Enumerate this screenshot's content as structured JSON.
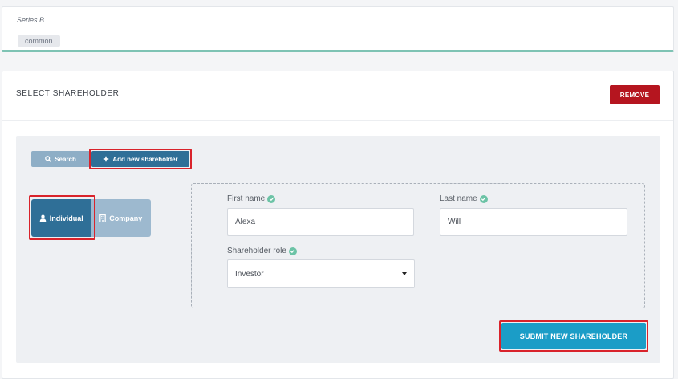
{
  "series": {
    "name": "Series B",
    "share_class": "common"
  },
  "shareholder_card": {
    "title": "SELECT SHAREHOLDER",
    "remove_label": "REMOVE"
  },
  "toolbar": {
    "search_label": "Search",
    "add_label": "Add new shareholder"
  },
  "type_toggle": {
    "individual_label": "Individual",
    "company_label": "Company",
    "selected": "Individual"
  },
  "form": {
    "first_name_label": "First name",
    "first_name_value": "Alexa",
    "last_name_label": "Last name",
    "last_name_value": "Will",
    "role_label": "Shareholder role",
    "role_value": "Investor"
  },
  "submit_label": "SUBMIT NEW SHAREHOLDER",
  "colors": {
    "primary": "#2f6f97",
    "danger": "#b5151f",
    "submit": "#1b9dc7",
    "valid": "#6cc3a6",
    "highlight": "#d9232b"
  },
  "icons": {
    "search": "search-icon",
    "add": "plus-icon",
    "individual": "user-icon",
    "company": "building-icon",
    "valid": "check-circle-icon",
    "dropdown": "caret-down-icon"
  }
}
